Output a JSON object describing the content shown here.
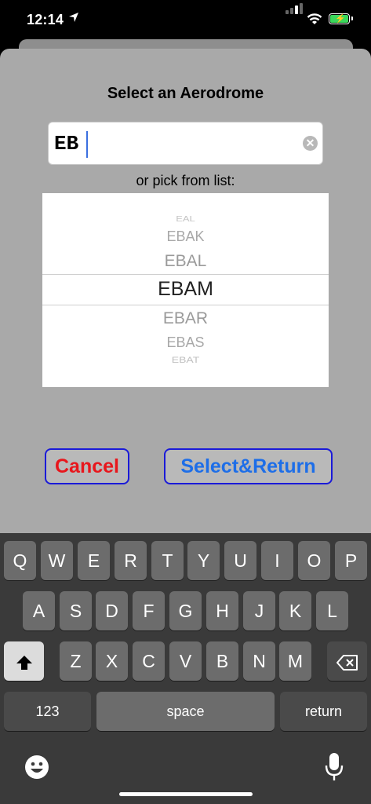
{
  "status_bar": {
    "time": "12:14"
  },
  "dialog": {
    "title": "Select an Aerodrome",
    "search_value": "EB",
    "pick_label": "or pick from list:",
    "picker_options": [
      "EAL",
      "EBAK",
      "EBAL",
      "EBAM",
      "EBAR",
      "EBAS",
      "EBAT"
    ],
    "selected_option": "EBAM",
    "cancel_label": "Cancel",
    "select_label": "Select&Return"
  },
  "keyboard": {
    "row1": [
      "Q",
      "W",
      "E",
      "R",
      "T",
      "Y",
      "U",
      "I",
      "O",
      "P"
    ],
    "row2": [
      "A",
      "S",
      "D",
      "F",
      "G",
      "H",
      "J",
      "K",
      "L"
    ],
    "row3": [
      "Z",
      "X",
      "C",
      "V",
      "B",
      "N",
      "M"
    ],
    "numbers_label": "123",
    "space_label": "space",
    "return_label": "return"
  },
  "colors": {
    "cancel": "#e8161c",
    "select": "#1d6ee8",
    "button_border": "#1a1ad8",
    "battery": "#3bd75b"
  }
}
